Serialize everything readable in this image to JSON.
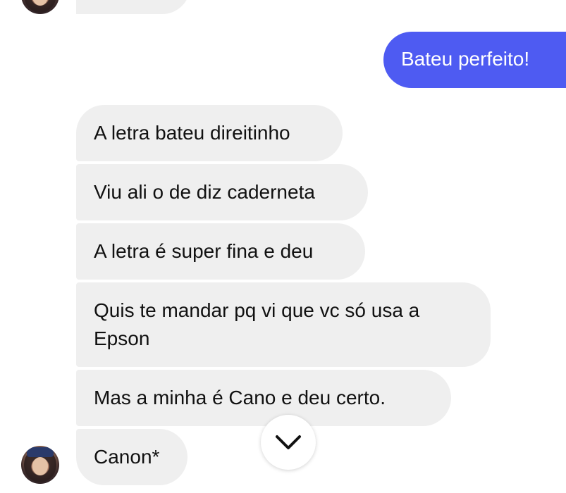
{
  "thread": {
    "outgoing": [
      {
        "text": "Bateu perfeito!"
      }
    ],
    "incoming": [
      {
        "text": "A letra bateu direitinho"
      },
      {
        "text": "Viu ali o de diz caderneta"
      },
      {
        "text": "A letra é super fina e deu"
      },
      {
        "text": "Quis te mandar pq vi que vc só usa a",
        "text2": "Epson"
      },
      {
        "text": "Mas a minha é Cano  e deu certo."
      },
      {
        "text": "Canon*"
      }
    ]
  },
  "icons": {
    "scroll_down": "chevron-down-icon",
    "avatar": "contact-avatar"
  },
  "colors": {
    "outgoing_bubble": "#4e5bf2",
    "incoming_bubble": "#efefef",
    "text": "#111111"
  }
}
